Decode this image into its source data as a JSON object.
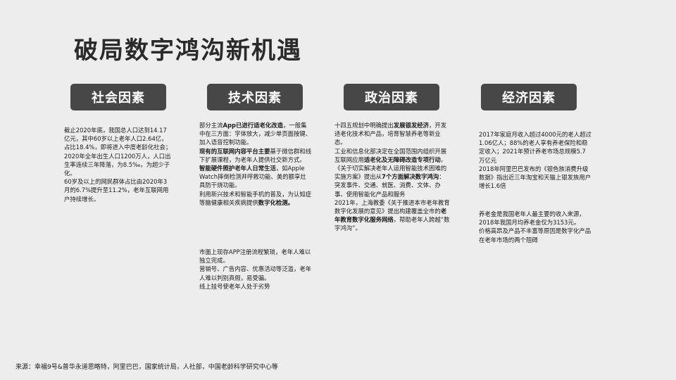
{
  "title": "破局数字鸿沟新机遇",
  "categories": {
    "social": "社会因素",
    "tech": "技术因素",
    "politics": "政治因素",
    "economy": "经济因素"
  },
  "social": {
    "p1": "截止2020年底，我国总人口达到14.17亿元，其中60岁以上老年人口2.64亿，占比18.4%，即将进入中度老龄化社会；2020年全年出生人口1200万人，人口出生率连续三年降落，为8.5‰，为超少子化。",
    "p2": "60岁及以上的网民群体占比由2020年3月的6.7%提升至11.2%，老年互联网用户持续增长。"
  },
  "tech": {
    "a1": "部分主流",
    "a2": "App已进行适老化改造",
    "a3": "，一般集中在三方面：字体放大，减少单页面按键、加入语音控制功能。",
    "b1": "现有的互联网内容平台主要",
    "b2": "基于微信群和线下扩展课程，为老年人提供社交新方式。",
    "c1": "智能硬件照护老年人日常生活",
    "c2": "，如Apple Watch摔倒检测并呼救功能、美的额享灶具防干烧功能。",
    "d1": "利用新兴技术和智能手机的普及，为认知症等脑健康相关疾病提供",
    "d2": "数字化检测。",
    "e1": "市面上现存APP注册流程繁琐，老年人难以独立完成。",
    "e2": "营销号、广告内容、优惠活动等泛滥，老年人难以判别真假，易受骗。",
    "e3": "线上挂号使老年人处于劣势"
  },
  "politics": {
    "a1": "十四五规划中明确提出",
    "a2": "发展银发经济",
    "a3": "，开发适老化技术和产品，培育智慧养老等新业态。",
    "b1": "工业和信息化部决定在全国范围内组织开展互联网应用",
    "b2": "适老化及无障碍改造专项行动",
    "b3": "。",
    "c1": "《关于切实解决老年人运用智能技术困难的实施方案》提出从",
    "c2": "7个方面解决数字鸿沟",
    "c3": "：突发事件、交通、就医、消费、文体、办事、使用智能化产品和服务",
    "d1": "2021年，上海教委《关于推进本市老年教育数字化发展的意见》提出构建覆盖全市的",
    "d2": "老年教育数字化服务网络",
    "d3": "，帮助老年人跨越“数字鸿沟”。"
  },
  "economy": {
    "p1": "2017年家庭月收入超过4000元的老人超过1.06亿人；88%的老人享有养老保险和稳定收入；2021年预计养老市场总规模5.7万亿元",
    "p2": "2018年阿里巴巴发布的《银色族消费升级数据》指出近三年淘宝和天猫上银发族用户增长1.6倍",
    "p3": "养老金是我国老年人最主要的收入来源，2018年我国月均养老金仅为3153元。",
    "p4": "价格高昂及产品不丰富等原因是数字化产品在老年市场的两个阻碍"
  },
  "source": "来源：幸福9号&普华永道思略特，阿里巴巴，国家统计局，人社部，中国老龄科学研究中心等"
}
